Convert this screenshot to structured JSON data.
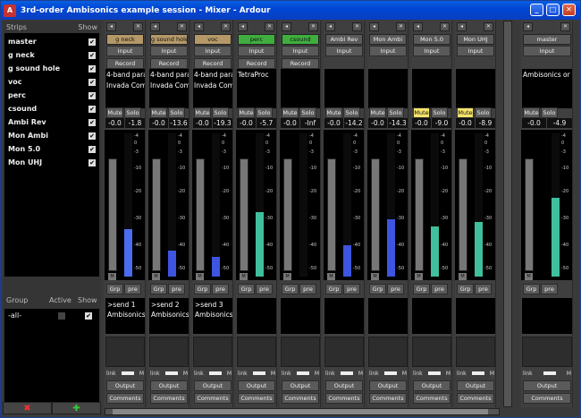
{
  "window": {
    "title": "3rd-order Ambisonics example session - Mixer - Ardour",
    "minimize": "_",
    "maximize": "□",
    "close": "✕"
  },
  "strips_panel": {
    "header_strips": "Strips",
    "header_show": "Show",
    "items": [
      {
        "name": "master",
        "show": "✔"
      },
      {
        "name": "g neck",
        "show": "✔"
      },
      {
        "name": "g sound hole",
        "show": "✔"
      },
      {
        "name": "voc",
        "show": "✔"
      },
      {
        "name": "perc",
        "show": "✔"
      },
      {
        "name": "csound",
        "show": "✔"
      },
      {
        "name": "Ambi Rev",
        "show": "✔"
      },
      {
        "name": "Mon Ambi",
        "show": "✔"
      },
      {
        "name": "Mon 5.0",
        "show": "✔"
      },
      {
        "name": "Mon UHJ",
        "show": "✔"
      }
    ]
  },
  "group_panel": {
    "header_group": "Group",
    "header_active": "Active",
    "header_show": "Show",
    "items": [
      {
        "name": "-all-",
        "show": "✔"
      }
    ],
    "remove_button": "✖",
    "add_button": "✚"
  },
  "strips": [
    {
      "name": "g neck",
      "name_color": "#b49868",
      "input": "Input",
      "record": "Record",
      "plugins": [
        "4-band para",
        "Invada Com"
      ],
      "mute": "Mute",
      "solo": "Solo",
      "gain": "-0.0",
      "peak": "-1.8",
      "grp": "Grp",
      "pre": "pre",
      "comments_text": [
        ">send 1",
        "Ambisonics"
      ],
      "link": "link",
      "m": "M",
      "output": "Output",
      "comments": "Comments",
      "meter_level": 0.33,
      "meter_color": "#4a6cf0",
      "mute_active": false
    },
    {
      "name": "g sound hole",
      "name_color": "#b49868",
      "input": "Input",
      "record": "Record",
      "plugins": [
        "4-band para",
        "Invada Com"
      ],
      "mute": "Mute",
      "solo": "Solo",
      "gain": "-0.0",
      "peak": "-13.6",
      "grp": "Grp",
      "pre": "pre",
      "comments_text": [
        ">send 2",
        "Ambisonics"
      ],
      "link": "link",
      "m": "M",
      "output": "Output",
      "comments": "Comments",
      "meter_level": 0.18,
      "meter_color": "#3d55e0",
      "mute_active": false
    },
    {
      "name": "voc",
      "name_color": "#b49868",
      "input": "Input",
      "record": "Record",
      "plugins": [
        "4-band para",
        "Invada Com"
      ],
      "mute": "Mute",
      "solo": "Solo",
      "gain": "-0.0",
      "peak": "-19.3",
      "grp": "Grp",
      "pre": "pre",
      "comments_text": [
        ">send 3",
        "Ambisonics"
      ],
      "link": "link",
      "m": "M",
      "output": "Output",
      "comments": "Comments",
      "meter_level": 0.14,
      "meter_color": "#3d55e0",
      "mute_active": false
    },
    {
      "name": "perc",
      "name_color": "#3fae3f",
      "input": "Input",
      "record": "Record",
      "plugins": [
        "TetraProc"
      ],
      "mute": "Mute",
      "solo": "Solo",
      "gain": "-0.0",
      "peak": "-5.7",
      "grp": "Grp",
      "pre": "pre",
      "comments_text": [],
      "link": "link",
      "m": "M",
      "output": "Output",
      "comments": "Comments",
      "meter_level": 0.45,
      "meter_color": "#3fbf9c",
      "mute_active": false
    },
    {
      "name": "csound",
      "name_color": "#3fae3f",
      "input": "Input",
      "record": "Record",
      "plugins": [],
      "mute": "Mute",
      "solo": "Solo",
      "gain": "-0.0",
      "peak": "-Inf",
      "grp": "Grp",
      "pre": "pre",
      "comments_text": [],
      "link": "link",
      "m": "M",
      "output": "Output",
      "comments": "Comments",
      "meter_level": 0,
      "meter_color": "#222222",
      "mute_active": false
    },
    {
      "name": "Ambi Rev",
      "name_color": "#5a5a5a",
      "input": "Input",
      "record": "",
      "plugins": [],
      "mute": "Mute",
      "solo": "Solo",
      "gain": "-0.0",
      "peak": "-14.2",
      "grp": "Grp",
      "pre": "pre",
      "comments_text": [],
      "link": "link",
      "m": "M",
      "output": "Output",
      "comments": "Comments",
      "meter_level": 0.22,
      "meter_color": "#3d55e0",
      "mute_active": false
    },
    {
      "name": "Mon Ambi",
      "name_color": "#5a5a5a",
      "input": "Input",
      "record": "",
      "plugins": [],
      "mute": "Mute",
      "solo": "Solo",
      "gain": "-0.0",
      "peak": "-14.3",
      "grp": "Grp",
      "pre": "pre",
      "comments_text": [],
      "link": "link",
      "m": "M",
      "output": "Output",
      "comments": "Comments",
      "meter_level": 0.4,
      "meter_color": "#3d55e0",
      "mute_active": false
    },
    {
      "name": "Mon 5.0",
      "name_color": "#5a5a5a",
      "input": "Input",
      "record": "",
      "plugins": [],
      "mute": "Mute",
      "solo": "Solo",
      "gain": "-0.0",
      "peak": "-9.0",
      "grp": "Grp",
      "pre": "pre",
      "comments_text": [],
      "link": "link",
      "m": "M",
      "output": "Output",
      "comments": "Comments",
      "meter_level": 0.35,
      "meter_color": "#3fbf9c",
      "mute_active": true
    },
    {
      "name": "Mon UHJ",
      "name_color": "#5a5a5a",
      "input": "Input",
      "record": "",
      "plugins": [],
      "mute": "Mute",
      "solo": "Solo",
      "gain": "-0.0",
      "peak": "-8.9",
      "grp": "Grp",
      "pre": "pre",
      "comments_text": [],
      "link": "link",
      "m": "M",
      "output": "Output",
      "comments": "Comments",
      "meter_level": 0.38,
      "meter_color": "#3fbf9c",
      "mute_active": true
    }
  ],
  "master_strip": {
    "name": "master",
    "input": "Input",
    "plugins": [
      "Ambisonics or"
    ],
    "mute": "Mute",
    "solo": "Solo",
    "gain": "-0.0",
    "peak": "-4.9",
    "grp": "Grp",
    "pre": "pre",
    "link": "link",
    "m": "M",
    "output": "Output",
    "comments": "Comments",
    "meter_level": 0.55
  },
  "meter_scale": [
    "-4",
    "0",
    "-3",
    "-10",
    "-20",
    "-30",
    "-40",
    "-50"
  ],
  "colors": {
    "mute_active": "#f5e36a",
    "meter_blue": "#3d55e0",
    "meter_green": "#3fbf9c"
  }
}
